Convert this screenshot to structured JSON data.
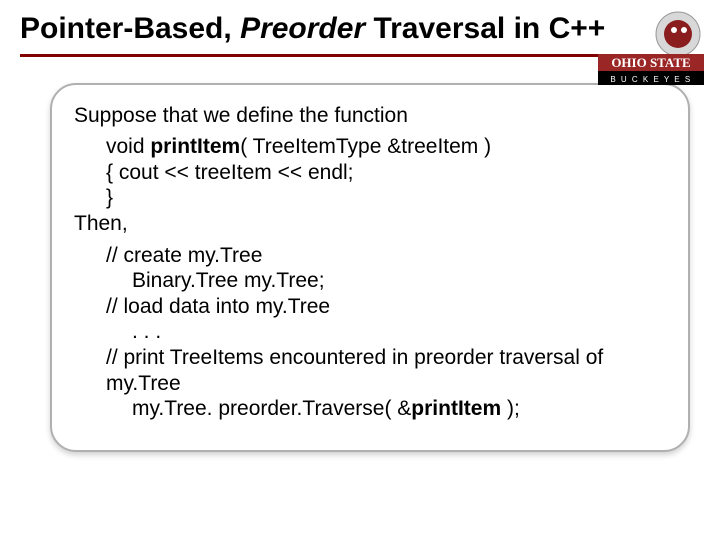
{
  "title": {
    "part1": "Pointer-Based, ",
    "italic": "Preorder",
    "part2": " Traversal in C++"
  },
  "logo": {
    "top_text": "OHIO STATE",
    "bottom_text": "B U C K E Y E S"
  },
  "content": {
    "l1": "Suppose that we define the function",
    "l2a": "void  ",
    "l2b": "printItem",
    "l2c": "( TreeItemType  &treeItem )",
    "l3": "{  cout << treeItem << endl;",
    "l4": "}",
    "l5": "Then,",
    "l6": "// create my.Tree",
    "l7": "Binary.Tree   my.Tree;",
    "l8": "// load data into my.Tree",
    "l9": ". . .",
    "l10": "// print TreeItems encountered in preorder traversal of my.Tree",
    "l11a": "my.Tree. preorder.Traverse( &",
    "l11b": "printItem",
    "l11c": " );"
  }
}
